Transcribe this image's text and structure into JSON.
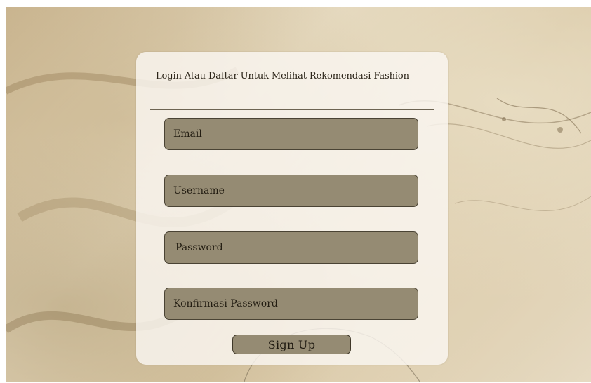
{
  "form": {
    "title": "Login  Atau Daftar Untuk Melihat Rekomendasi Fashion",
    "fields": {
      "email": "Email",
      "username": "Username",
      "password": "Password",
      "confirm_password": "Konfirmasi Password"
    },
    "submit_label": "Sign Up"
  },
  "colors": {
    "field_fill": "#958b73",
    "field_border": "#4a4334",
    "card_bg": "#faf7f1",
    "background": "#d8c6a3"
  }
}
